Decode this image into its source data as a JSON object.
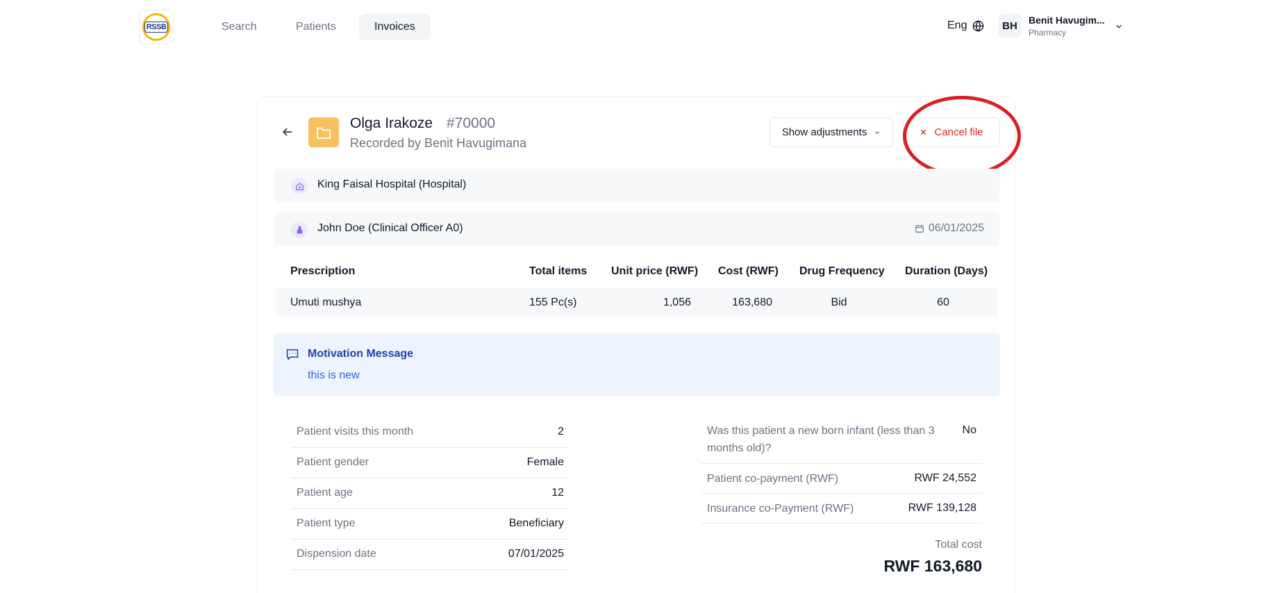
{
  "nav": {
    "logo_text": "RSSB",
    "items": [
      {
        "label": "Search"
      },
      {
        "label": "Patients"
      },
      {
        "label": "Invoices"
      }
    ],
    "active": "Invoices",
    "language": "Eng",
    "user": {
      "initials": "BH",
      "name": "Benit Havugim...",
      "role": "Pharmacy"
    }
  },
  "file": {
    "patient_name": "Olga Irakoze",
    "id": "#70000",
    "recorded_by": "Recorded by Benit Havugimana",
    "show_adjustments_label": "Show adjustments",
    "cancel_label": "Cancel file"
  },
  "facility": {
    "name": "King Faisal Hospital (Hospital)"
  },
  "prescriber": {
    "name": "John Doe (Clinical Officer A0)",
    "date": "06/01/2025"
  },
  "table": {
    "headers": [
      "Prescription",
      "Total items",
      "Unit price (RWF)",
      "Cost (RWF)",
      "Drug Frequency",
      "Duration (Days)"
    ],
    "rows": [
      [
        "Umuti mushya",
        "155 Pc(s)",
        "1,056",
        "163,680",
        "Bid",
        "60"
      ]
    ]
  },
  "motivation": {
    "title": "Motivation Message",
    "body": "this is new"
  },
  "patient_stats": [
    {
      "label": "Patient visits this month",
      "value": "2"
    },
    {
      "label": "Patient gender",
      "value": "Female"
    },
    {
      "label": "Patient age",
      "value": "12"
    },
    {
      "label": "Patient type",
      "value": "Beneficiary"
    },
    {
      "label": "Dispension date",
      "value": "07/01/2025"
    }
  ],
  "payment": {
    "newborn_label": "Was this patient a new born infant (less than 3 months old)?",
    "newborn_value": "No",
    "copay_label": "Patient co-payment (RWF)",
    "copay_value": "RWF 24,552",
    "insurance_label": "Insurance co-Payment (RWF)",
    "insurance_value": "RWF 139,128",
    "total_label": "Total cost",
    "total_value": "RWF 163,680"
  },
  "colors": {
    "accent_folder": "#f6c15e",
    "danger": "#dc2626",
    "annotation": "#dc1f26",
    "info_blue": "#1e40af"
  }
}
